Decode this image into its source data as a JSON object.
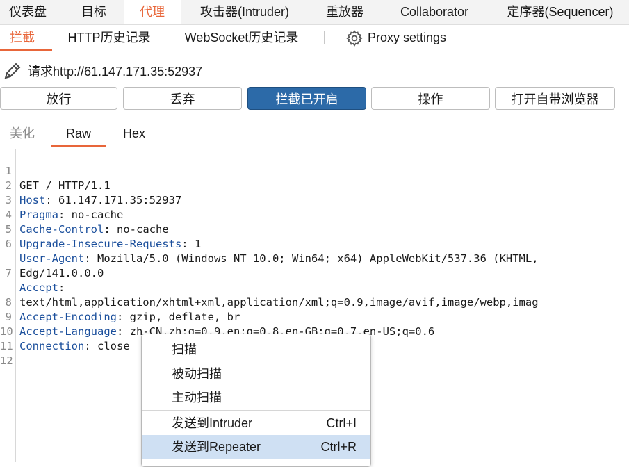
{
  "topnav": {
    "tabs": [
      {
        "label": "仪表盘"
      },
      {
        "label": "目标"
      },
      {
        "label": "代理",
        "active": true
      },
      {
        "label": "攻击器(Intruder)"
      },
      {
        "label": "重放器"
      },
      {
        "label": "Collaborator"
      },
      {
        "label": "定序器(Sequencer)"
      }
    ]
  },
  "subnav": {
    "tabs": [
      {
        "label": "拦截",
        "active": true
      },
      {
        "label": "HTTP历史记录"
      },
      {
        "label": "WebSocket历史记录"
      }
    ],
    "settings_label": "Proxy settings",
    "settings_icon": "gear-icon"
  },
  "request": {
    "label": "请求http://61.147.171.35:52937",
    "icon": "pencil-icon"
  },
  "buttons": {
    "forward": "放行",
    "drop": "丢弃",
    "intercept": "拦截已开启",
    "action": "操作",
    "browser": "打开自带浏览器"
  },
  "editor_tabs": {
    "pretty": "美化",
    "raw": "Raw",
    "hex": "Hex"
  },
  "editor": {
    "lines": [
      {
        "num": "1",
        "key": "",
        "value": "GET / HTTP/1.1"
      },
      {
        "num": "2",
        "key": "Host",
        "value": ": 61.147.171.35:52937"
      },
      {
        "num": "3",
        "key": "Pragma",
        "value": ": no-cache"
      },
      {
        "num": "4",
        "key": "Cache-Control",
        "value": ": no-cache"
      },
      {
        "num": "5",
        "key": "Upgrade-Insecure-Requests",
        "value": ": 1"
      },
      {
        "num": "6",
        "key": "User-Agent",
        "value": ": Mozilla/5.0 (Windows NT 10.0; Win64; x64) AppleWebKit/537.36 (KHTML,"
      },
      {
        "num": "",
        "key": "",
        "value": "Edg/141.0.0.0"
      },
      {
        "num": "7",
        "key": "Accept",
        "value": ":"
      },
      {
        "num": "",
        "key": "",
        "value": "text/html,application/xhtml+xml,application/xml;q=0.9,image/avif,image/webp,imag"
      },
      {
        "num": "8",
        "key": "Accept-Encoding",
        "value": ": gzip, deflate, br"
      },
      {
        "num": "9",
        "key": "Accept-Language",
        "value": ": zh-CN,zh;q=0.9,en;q=0.8,en-GB;q=0.7,en-US;q=0.6"
      },
      {
        "num": "10",
        "key": "Connection",
        "value": ": close"
      },
      {
        "num": "11",
        "key": "",
        "value": ""
      },
      {
        "num": "12",
        "key": "",
        "value": ""
      }
    ]
  },
  "context_menu": {
    "items": [
      {
        "label": "扫描",
        "shortcut": ""
      },
      {
        "label": "被动扫描",
        "shortcut": ""
      },
      {
        "label": "主动扫描",
        "shortcut": ""
      },
      {
        "label": "发送到Intruder",
        "shortcut": "Ctrl+I"
      },
      {
        "label": "发送到Repeater",
        "shortcut": "Ctrl+R",
        "highlighted": true
      }
    ]
  },
  "colors": {
    "accent": "#e8663a",
    "primary_button": "#2c6aa8",
    "header_key": "#1b4f9c",
    "menu_highlight": "#cfe0f3"
  }
}
